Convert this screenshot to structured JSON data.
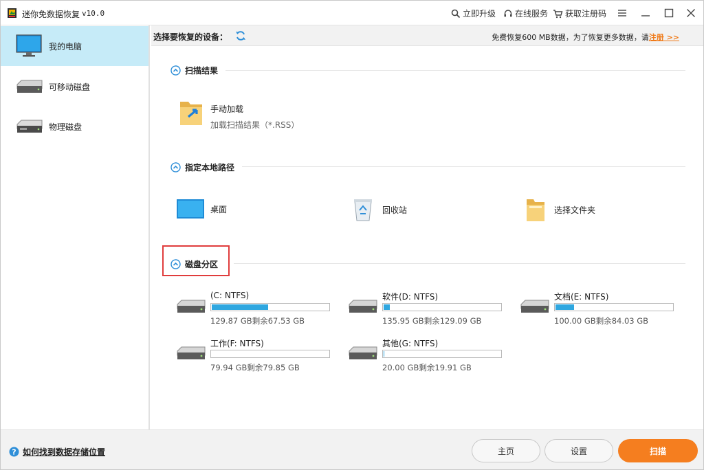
{
  "app": {
    "title": "迷你免数据恢复",
    "version": "v10.0"
  },
  "titlebar": {
    "upgrade_label": "立即升级",
    "service_label": "在线服务",
    "register_label": "获取注册码"
  },
  "sidebar": {
    "items": [
      {
        "label": "我的电脑",
        "icon": "monitor-icon",
        "active": true
      },
      {
        "label": "可移动磁盘",
        "icon": "drive-icon",
        "active": false
      },
      {
        "label": "物理磁盘",
        "icon": "physical-drive-icon",
        "active": false
      }
    ]
  },
  "toolbar": {
    "select_label": "选择要恢复的设备：",
    "promo_text": "免费恢复600 MB数据，为了恢复更多数据，请",
    "register_link": "注册 >>"
  },
  "sections": {
    "scan_results": {
      "title": "扫描结果",
      "manual_load_title": "手动加载",
      "manual_load_sub": "加载扫描结果（*.RSS）"
    },
    "local_path": {
      "title": "指定本地路径",
      "items": [
        "桌面",
        "回收站",
        "选择文件夹"
      ]
    },
    "partitions": {
      "title": "磁盘分区",
      "drives": [
        {
          "name": "(C: NTFS)",
          "size": "129.87 GB剩余67.53 GB",
          "used_fraction": 0.48
        },
        {
          "name": "软件(D: NTFS)",
          "size": "135.95 GB剩余129.09 GB",
          "used_fraction": 0.05
        },
        {
          "name": "文档(E: NTFS)",
          "size": "100.00 GB剩余84.03 GB",
          "used_fraction": 0.16
        },
        {
          "name": "工作(F: NTFS)",
          "size": "79.94 GB剩余79.85 GB",
          "used_fraction": 0.001
        },
        {
          "name": "其他(G: NTFS)",
          "size": "20.00 GB剩余19.91 GB",
          "used_fraction": 0.004
        }
      ]
    }
  },
  "bottombar": {
    "help_label": "如何找到数据存储位置",
    "home_label": "主页",
    "settings_label": "设置",
    "scan_label": "扫描"
  },
  "colors": {
    "accent": "#f57e1f",
    "selected": "#c6ebf8",
    "bar_fill": "#2fa7e0",
    "highlight": "#e03c3c"
  }
}
